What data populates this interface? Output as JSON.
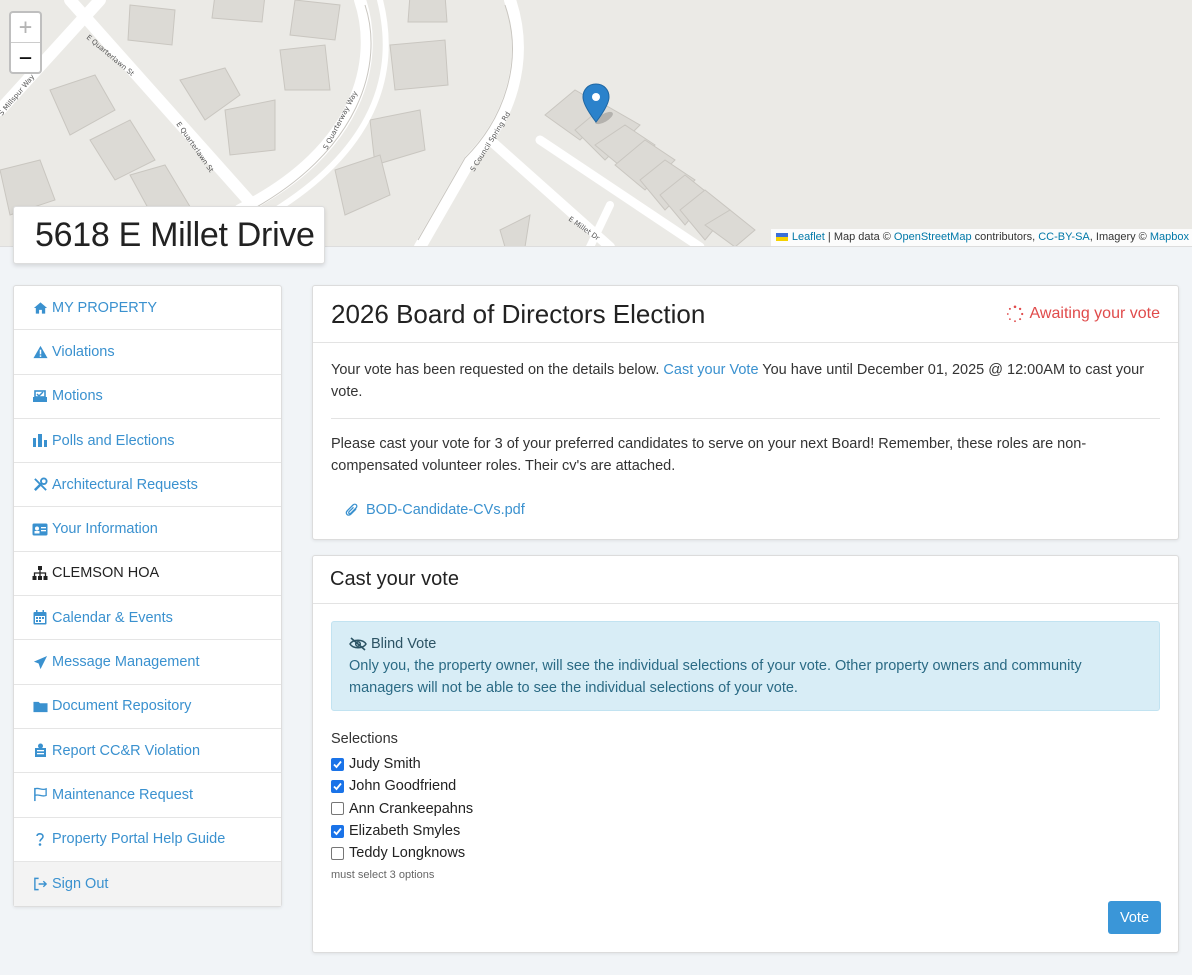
{
  "map": {
    "zoom_in": "+",
    "zoom_out": "−",
    "attribution": {
      "leaflet": "Leaflet",
      "sep1": " | Map data © ",
      "osm": "OpenStreetMap",
      "contrib": " contributors, ",
      "license": "CC-BY-SA",
      "imagery": ", Imagery © ",
      "mapbox": "Mapbox"
    },
    "streets": [
      "E Quarterlawn St",
      "E Quarterlawn St",
      "S Quarterway Way",
      "S Millspur Way",
      "S Council Spring Rd",
      "E Millet Dr"
    ]
  },
  "property": {
    "address": "5618 E Millet Drive"
  },
  "sidebar": {
    "items": [
      {
        "label": "MY PROPERTY",
        "icon": "home-icon"
      },
      {
        "label": "Violations",
        "icon": "warning-icon"
      },
      {
        "label": "Motions",
        "icon": "inbox-icon"
      },
      {
        "label": "Polls and Elections",
        "icon": "ballot-icon"
      },
      {
        "label": "Architectural Requests",
        "icon": "tools-icon"
      },
      {
        "label": "Your Information",
        "icon": "id-card-icon"
      },
      {
        "label": "CLEMSON HOA",
        "icon": "sitemap-icon"
      },
      {
        "label": "Calendar & Events",
        "icon": "calendar-icon"
      },
      {
        "label": "Message Management",
        "icon": "paper-plane-icon"
      },
      {
        "label": "Document Repository",
        "icon": "folder-icon"
      },
      {
        "label": "Report CC&R Violation",
        "icon": "report-icon"
      },
      {
        "label": "Maintenance Request",
        "icon": "flag-icon"
      },
      {
        "label": "Property Portal Help Guide",
        "icon": "help-icon"
      },
      {
        "label": "Sign Out",
        "icon": "sign-out-icon"
      }
    ]
  },
  "election": {
    "title": "2026 Board of Directors Election",
    "status": "Awaiting your vote",
    "intro_before": "Your vote has been requested on the details below. ",
    "cast_link": "Cast your Vote",
    "intro_after": " You have until December 01, 2025 @ 12:00AM to cast your vote.",
    "description": "Please cast your vote for 3 of your preferred candidates to serve on your next Board! Remember, these roles are non-compensated volunteer roles. Their cv's are attached.",
    "attachment": "BOD-Candidate-CVs.pdf"
  },
  "vote": {
    "title": "Cast your vote",
    "alert_title": "Blind Vote",
    "alert_text": "Only you, the property owner, will see the individual selections of your vote. Other property owners and community managers will not be able to see the individual selections of your vote.",
    "selections_label": "Selections",
    "options": [
      {
        "name": "Judy Smith",
        "checked": true
      },
      {
        "name": "John Goodfriend",
        "checked": true
      },
      {
        "name": "Ann Crankeepahns",
        "checked": false
      },
      {
        "name": "Elizabeth Smyles",
        "checked": true
      },
      {
        "name": "Teddy Longknows",
        "checked": false
      }
    ],
    "hint": "must select 3 options",
    "button": "Vote"
  },
  "colors": {
    "link": "#3a91cf",
    "status": "#e04b4b",
    "accent": "#3a96d8"
  }
}
